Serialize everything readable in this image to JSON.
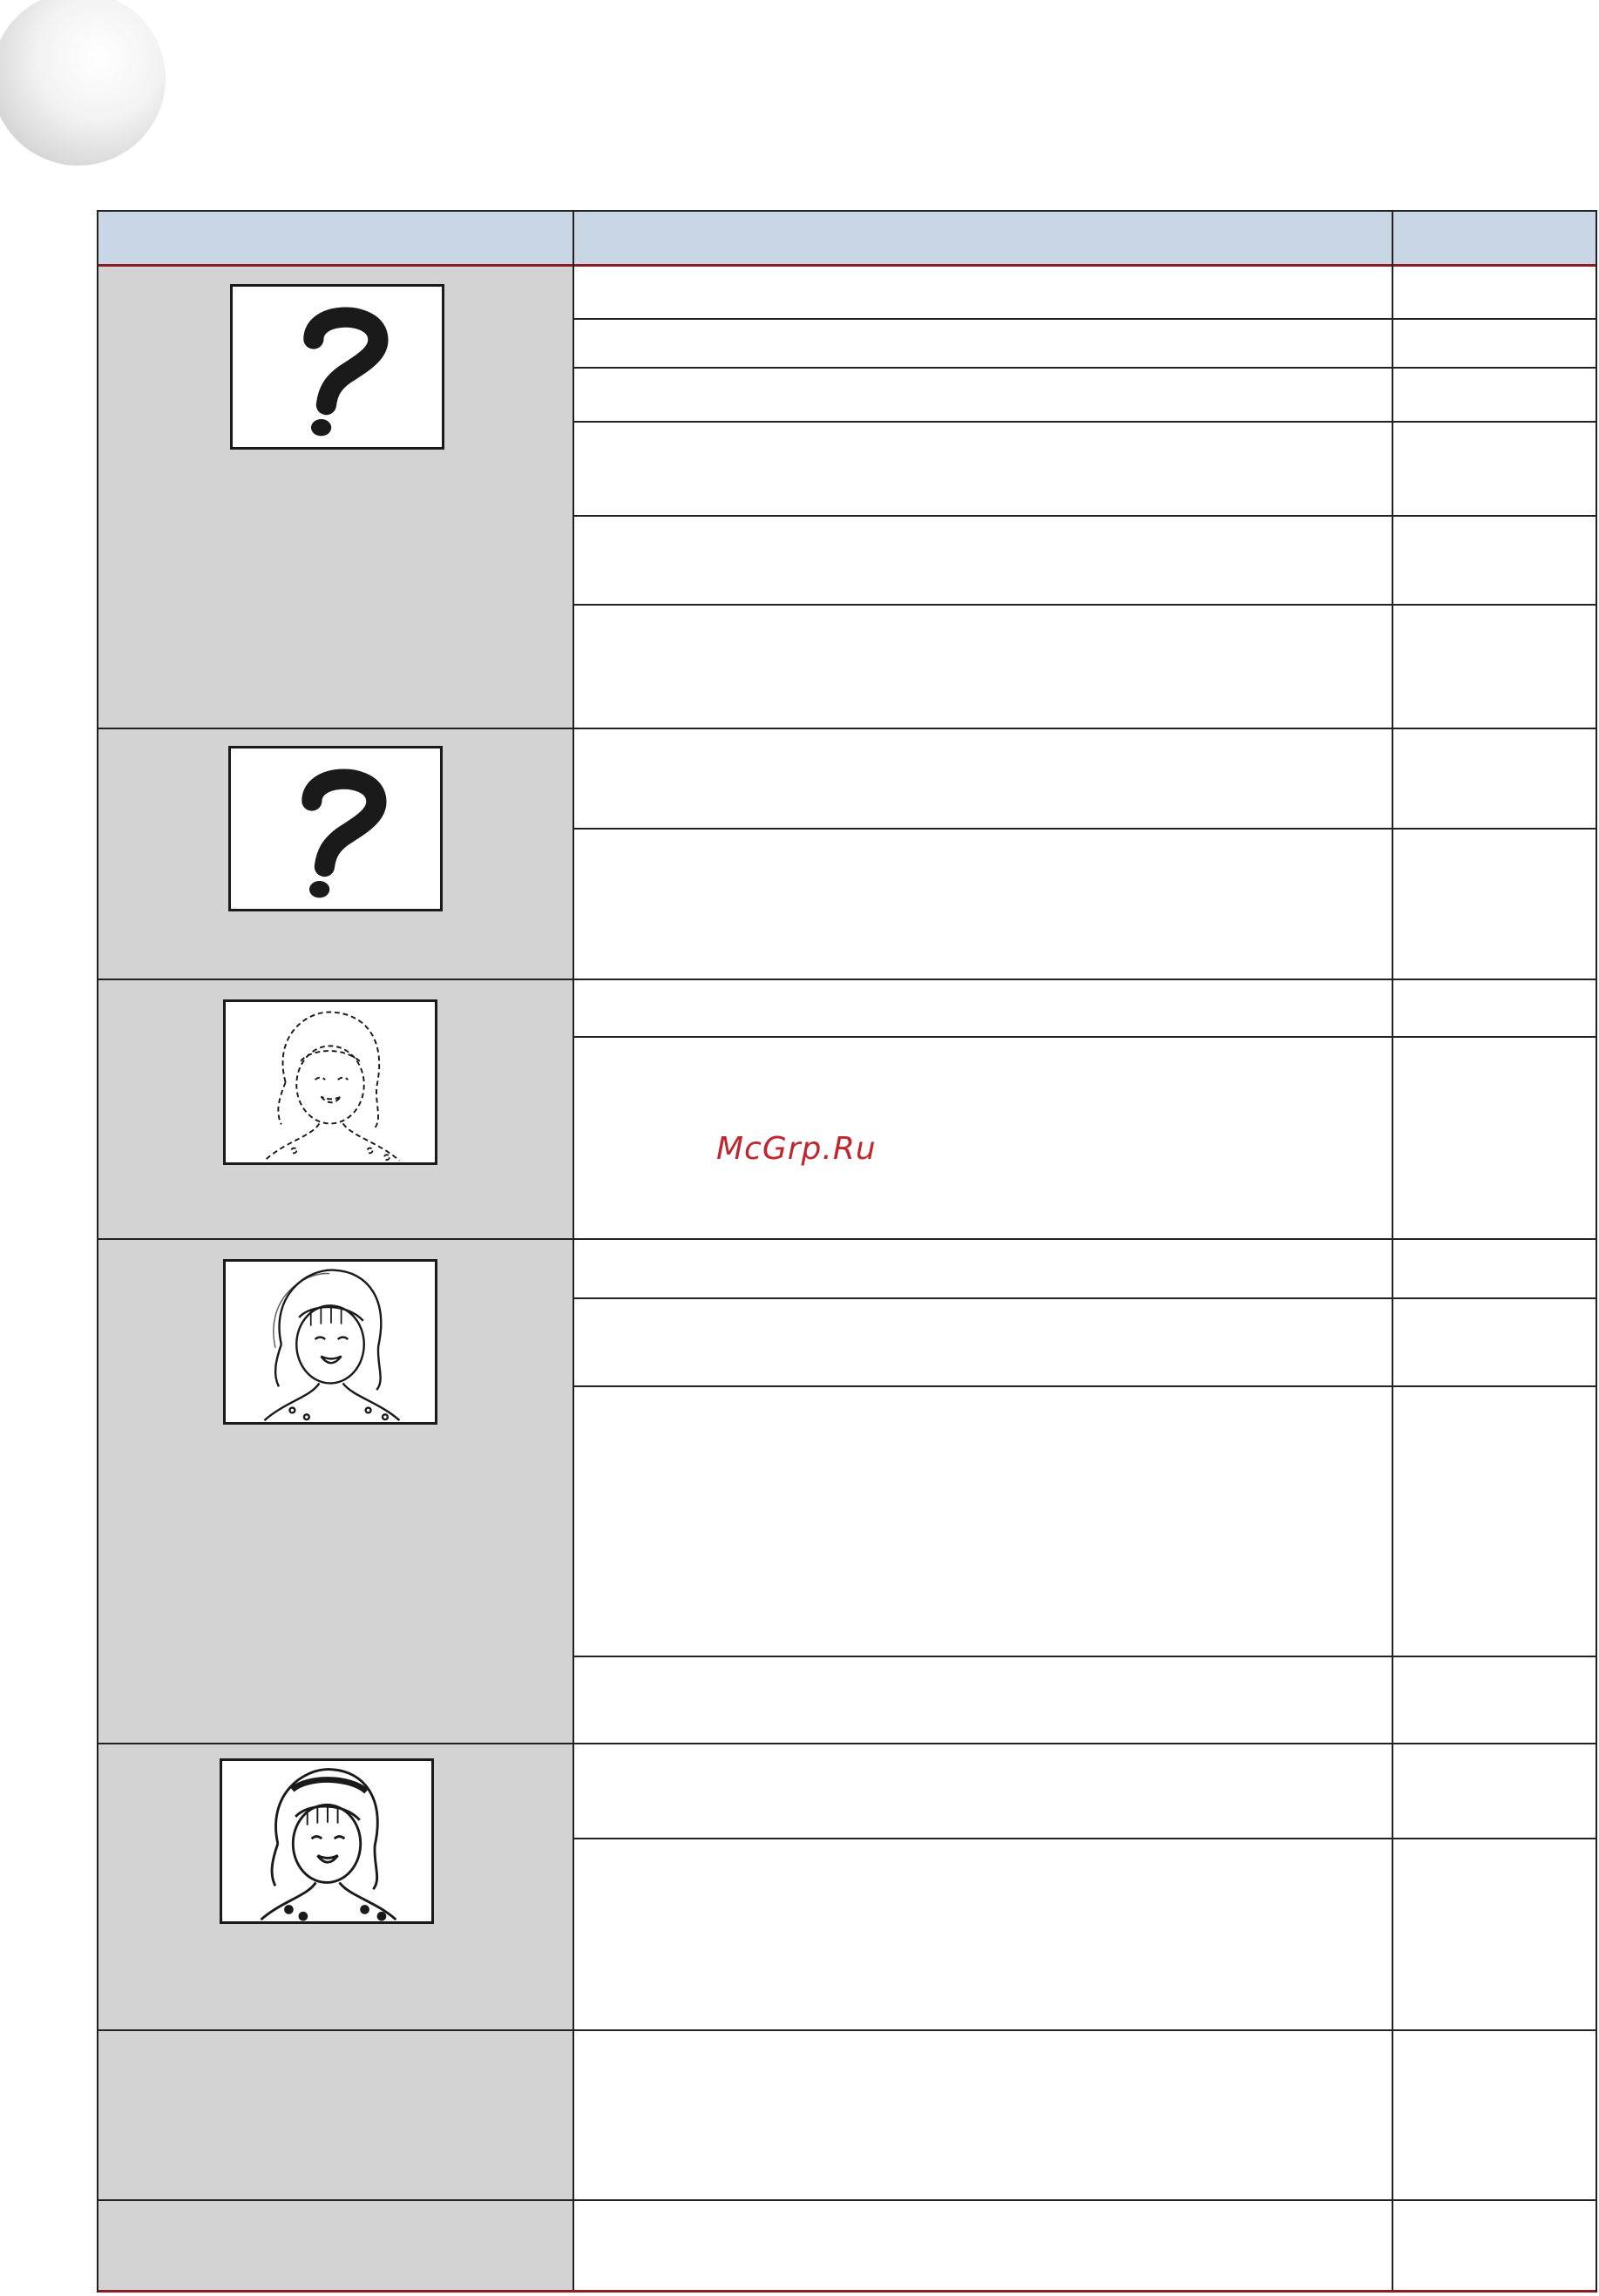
{
  "page": {
    "watermark": "McGrp.Ru",
    "colors": {
      "header_bg": "#c9d6e6",
      "header_rule": "#8a1c22",
      "left_col_bg": "#d3d3d3",
      "watermark": "#c0262d"
    }
  },
  "table": {
    "header": [
      "",
      "",
      ""
    ],
    "groups": [
      {
        "illustration": "question-mark-icon",
        "rows": [
          "",
          "",
          "",
          "",
          "",
          ""
        ]
      },
      {
        "illustration": "question-mark-icon",
        "rows": [
          "",
          ""
        ]
      },
      {
        "illustration": "faint-girl-portrait",
        "rows": [
          "",
          ""
        ]
      },
      {
        "illustration": "ghosted-girl-portrait",
        "rows": [
          "",
          "",
          "",
          ""
        ]
      },
      {
        "illustration": "clear-girl-portrait",
        "rows": [
          "",
          ""
        ]
      },
      {
        "illustration": "",
        "rows": [
          ""
        ]
      },
      {
        "illustration": "",
        "rows": [
          ""
        ]
      }
    ]
  }
}
